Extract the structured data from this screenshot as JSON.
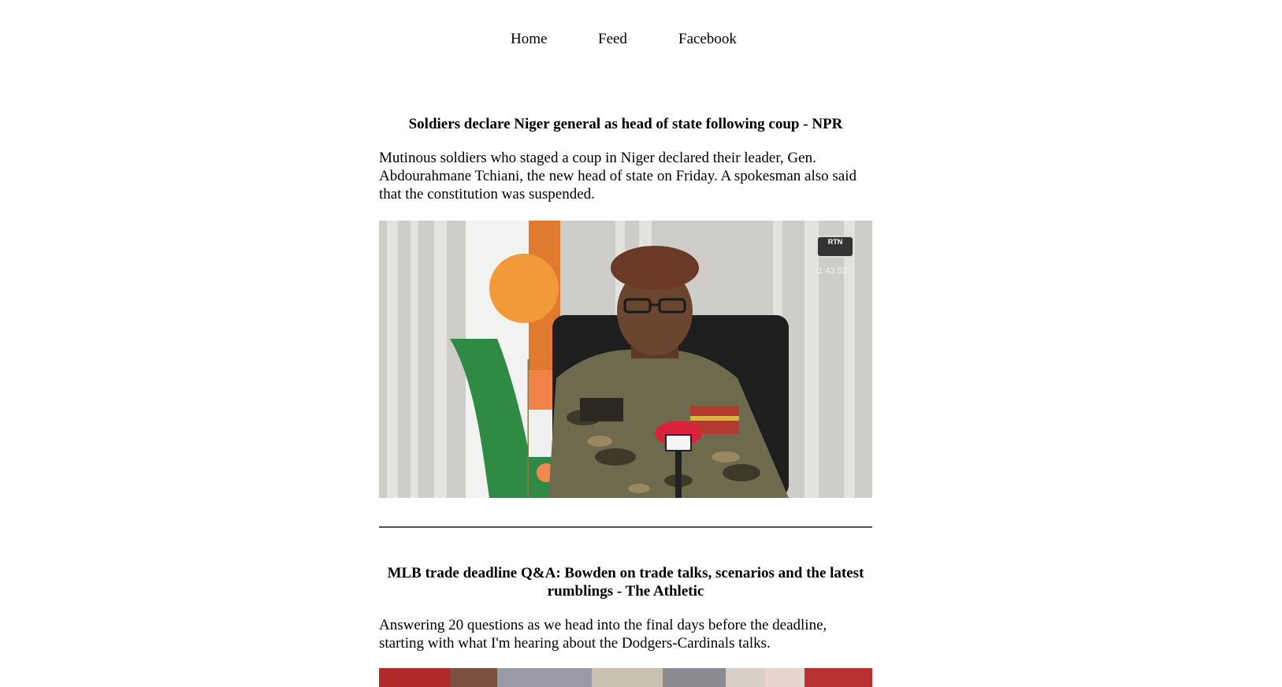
{
  "nav": {
    "home": "Home",
    "feed": "Feed",
    "facebook": "Facebook"
  },
  "articles": [
    {
      "title": "Soldiers declare Niger general as head of state following coup - NPR",
      "description": "Mutinous soldiers who staged a coup in Niger declared their leader, Gen. Abdourahmane Tchiani, the new head of state on Friday. A spokesman also said that the constitution was suspended.",
      "image_badge": "RTN",
      "image_clock": "11:43:52"
    },
    {
      "title": "MLB trade deadline Q&A: Bowden on trade talks, scenarios and the latest rumblings - The Athletic",
      "description": "Answering 20 questions as we head into the final days before the deadline, starting with what I'm hearing about the Dodgers-Cardinals talks."
    }
  ]
}
